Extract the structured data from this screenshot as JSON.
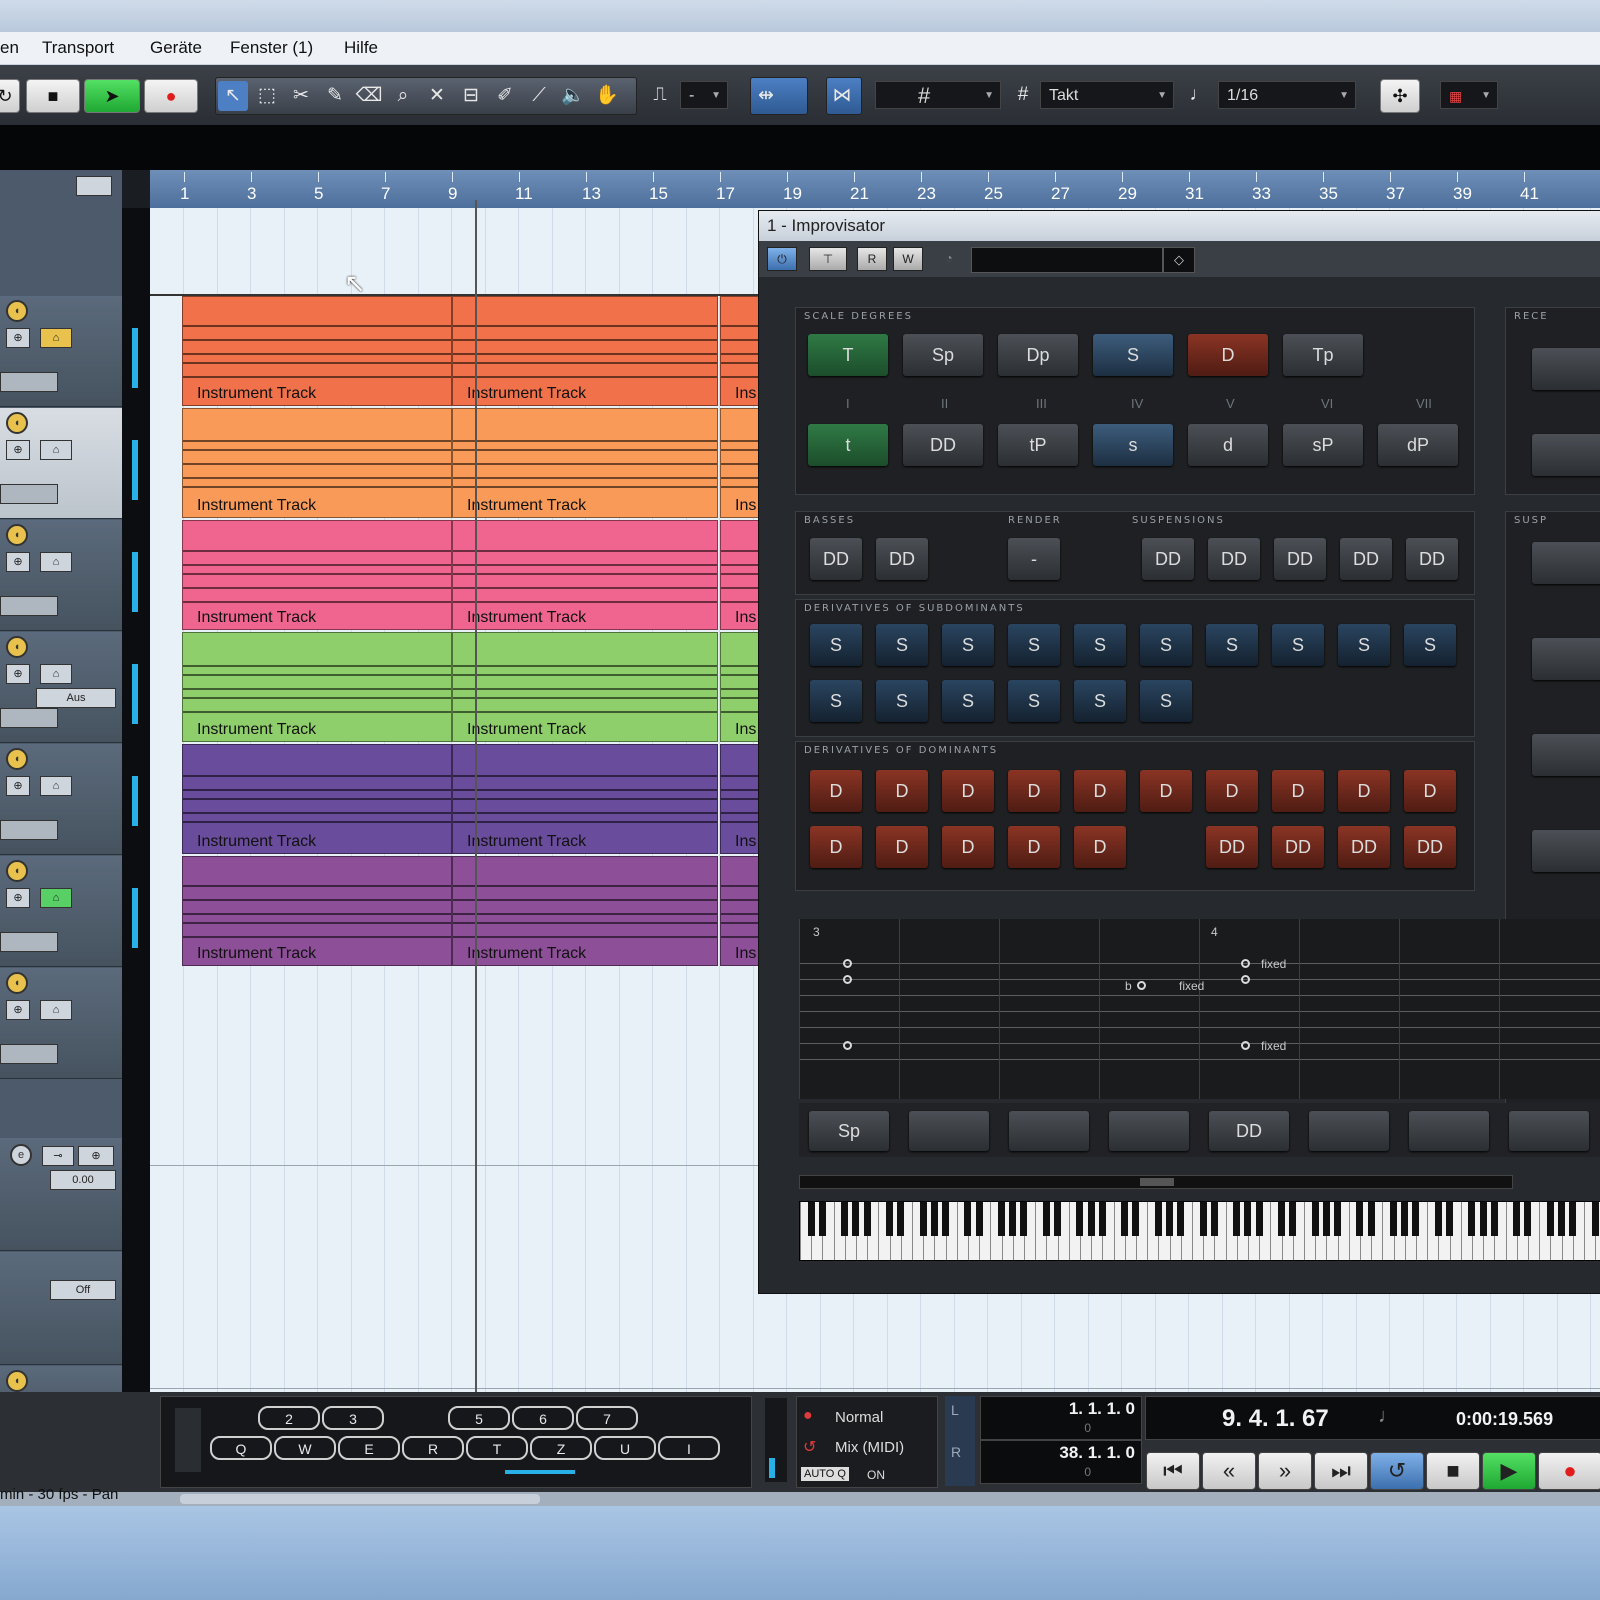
{
  "menubar": {
    "items": [
      "en",
      "Transport",
      "Geräte",
      "Fenster (1)",
      "Hilfe"
    ]
  },
  "toolbar": {
    "dropdown_dash": "-",
    "grid_type": "Takt",
    "quantize": "1/16"
  },
  "ruler": {
    "bars": [
      "1",
      "3",
      "5",
      "7",
      "9",
      "11",
      "13",
      "15",
      "17",
      "19",
      "21",
      "23",
      "25",
      "27",
      "29",
      "31",
      "33",
      "35",
      "37",
      "39",
      "41"
    ]
  },
  "tracks": {
    "part_label": "Instrument Track",
    "part_label_clipped": "Ins",
    "aus_label": "Aus",
    "value_000": "0.00",
    "off_label": "Off",
    "colors": [
      "#f0714a",
      "#f99a58",
      "#f06590",
      "#8fcf6b",
      "#6a4c9c",
      "#8d4f98"
    ]
  },
  "plugin": {
    "title": "1 - Improvisator",
    "toolbar_buttons": [
      "R",
      "W"
    ],
    "sections": {
      "scale_degrees": "SCALE DEGREES",
      "recent": "RECE",
      "basses": "BASSES",
      "render": "RENDER",
      "suspensions": "SUSPENSIONS",
      "susp2": "SUSP",
      "subdominants": "DERIVATIVES OF SUBDOMINANTS",
      "dominants": "DERIVATIVES OF DOMINANTS"
    },
    "degree_row1": [
      "T",
      "Sp",
      "Dp",
      "S",
      "D",
      "Tp"
    ],
    "degree_row2": [
      "t",
      "DD",
      "tP",
      "s",
      "d",
      "sP",
      "dP"
    ],
    "romans": [
      "I",
      "II",
      "III",
      "IV",
      "V",
      "VI",
      "VII"
    ],
    "basses": [
      "DD",
      "DD"
    ],
    "render": "-",
    "suspensions": [
      "DD",
      "DD",
      "DD",
      "DD",
      "DD"
    ],
    "subdominant_row1": [
      "S",
      "S",
      "S",
      "S",
      "S",
      "S",
      "S",
      "S",
      "S",
      "S"
    ],
    "subdominant_row2": [
      "S",
      "S",
      "S",
      "S",
      "S",
      "S"
    ],
    "dominant_row1": [
      "D",
      "D",
      "D",
      "D",
      "D",
      "D",
      "D",
      "D",
      "D",
      "D"
    ],
    "dominant_row2_left": [
      "D",
      "D",
      "D",
      "D",
      "D"
    ],
    "dominant_row2_right": [
      "DD",
      "DD",
      "DD",
      "DD"
    ],
    "staff": {
      "bar3": "3",
      "bar4": "4",
      "fixed": "fixed",
      "flat": "b"
    },
    "sequencer_slots": [
      "Sp",
      "",
      "",
      "",
      "DD",
      "",
      "",
      ""
    ]
  },
  "bottom": {
    "virtual_keys_top": [
      "2",
      "3",
      "5",
      "6",
      "7"
    ],
    "virtual_keys_bottom": [
      "Q",
      "W",
      "E",
      "R",
      "T",
      "Z",
      "U",
      "I"
    ],
    "mode_normal": "Normal",
    "mode_mix": "Mix (MIDI)",
    "auto_q": "AUTO Q",
    "auto_q_state": "ON",
    "left_locator": "1. 1. 1. 0",
    "right_locator": "38. 1. 1. 0",
    "small_zero": "0",
    "position": "9. 4. 1. 67",
    "time": "0:00:19.569",
    "status": "min - 30 fps - Pan"
  }
}
